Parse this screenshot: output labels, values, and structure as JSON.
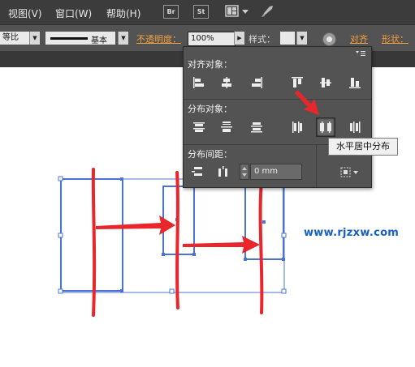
{
  "menu": {
    "view": "视图(V)",
    "window": "窗口(W)",
    "help": "帮助(H)",
    "br_badge": "Br",
    "st_badge": "St"
  },
  "controlbar": {
    "uniform": "等比",
    "stroke_profile": "基本",
    "opacity_label": "不透明度：",
    "opacity_value": "100%",
    "style_label": "样式：",
    "align_label": "对齐",
    "transform_label": "形状："
  },
  "align_panel": {
    "align_objects_title": "对齐对象：",
    "distribute_objects_title": "分布对象：",
    "distribute_spacing_title": "分布间距：",
    "spacing_value": "0 mm",
    "align_to_label": "对齐"
  },
  "tooltip": {
    "text": "水平居中分布"
  },
  "watermark": {
    "text": "www.rjzxw.com"
  },
  "colors": {
    "accent_orange": "#f0a040",
    "selection_blue": "#4b73d6",
    "annotation_red": "#e8262b",
    "watermark_blue": "#1560c8"
  }
}
